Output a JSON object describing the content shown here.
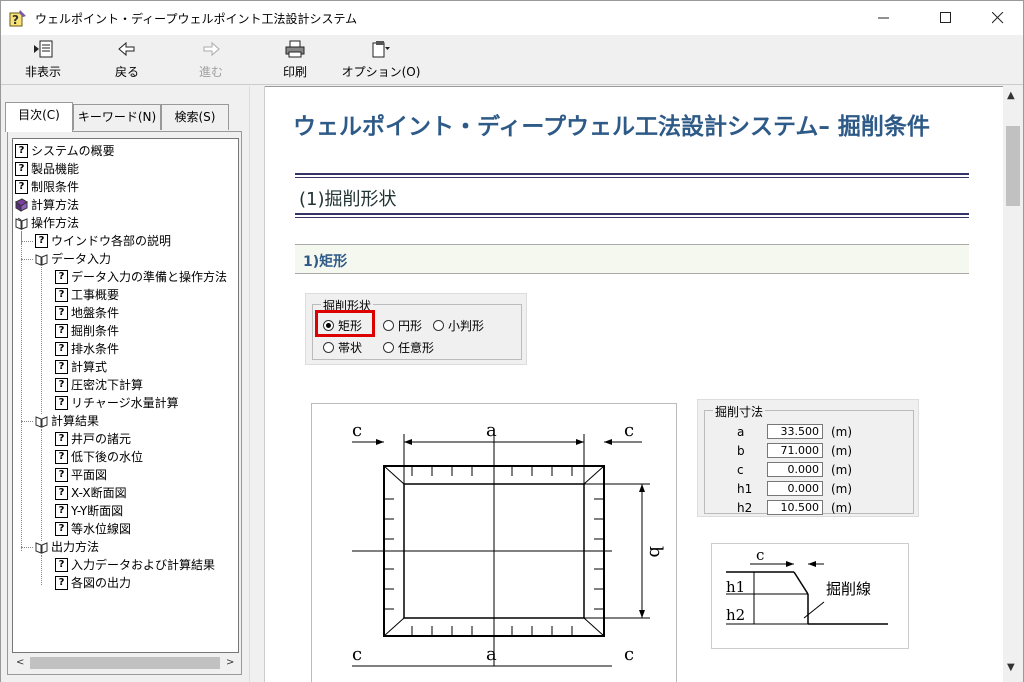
{
  "window": {
    "title": "ウェルポイント・ディープウェルポイント工法設計システム"
  },
  "toolbar": {
    "hide": "非表示",
    "back": "戻る",
    "forward": "進む",
    "print": "印刷",
    "options": "オプション(O)"
  },
  "tabs": {
    "contents": "目次(C)",
    "keyword": "キーワード(N)",
    "search": "検索(S)"
  },
  "tree": {
    "items": [
      "システムの概要",
      "製品機能",
      "制限条件",
      "計算方法",
      "操作方法",
      "ウインドウ各部の説明",
      "データ入力",
      "データ入力の準備と操作方法",
      "工事概要",
      "地盤条件",
      "掘削条件",
      "排水条件",
      "計算式",
      "圧密沈下計算",
      "リチャージ水量計算",
      "計算結果",
      "井戸の諸元",
      "低下後の水位",
      "平面図",
      "X-X断面図",
      "Y-Y断面図",
      "等水位線図",
      "出力方法",
      "入力データおよび計算結果",
      "各図の出力"
    ]
  },
  "doc": {
    "title": "ウェルポイント・ディープウェル工法設計システム– 掘削条件",
    "section1": "(1)掘削形状",
    "section2": "1)矩形",
    "shape_panel": {
      "legend": "掘削形状",
      "options": [
        "矩形",
        "円形",
        "小判形",
        "帯状",
        "任意形"
      ],
      "selected": "矩形"
    },
    "dims_panel": {
      "legend": "掘削寸法",
      "rows": [
        {
          "label": "a",
          "value": "33.500",
          "unit": "(m)"
        },
        {
          "label": "b",
          "value": "71.000",
          "unit": "(m)"
        },
        {
          "label": "c",
          "value": "0.000",
          "unit": "(m)"
        },
        {
          "label": "h1",
          "value": "0.000",
          "unit": "(m)"
        },
        {
          "label": "h2",
          "value": "10.500",
          "unit": "(m)"
        }
      ]
    },
    "plan_labels": {
      "a": "a",
      "b": "b",
      "c": "c"
    },
    "section_labels": {
      "c": "c",
      "h1": "h1",
      "h2": "h2",
      "line": "掘削線"
    }
  }
}
